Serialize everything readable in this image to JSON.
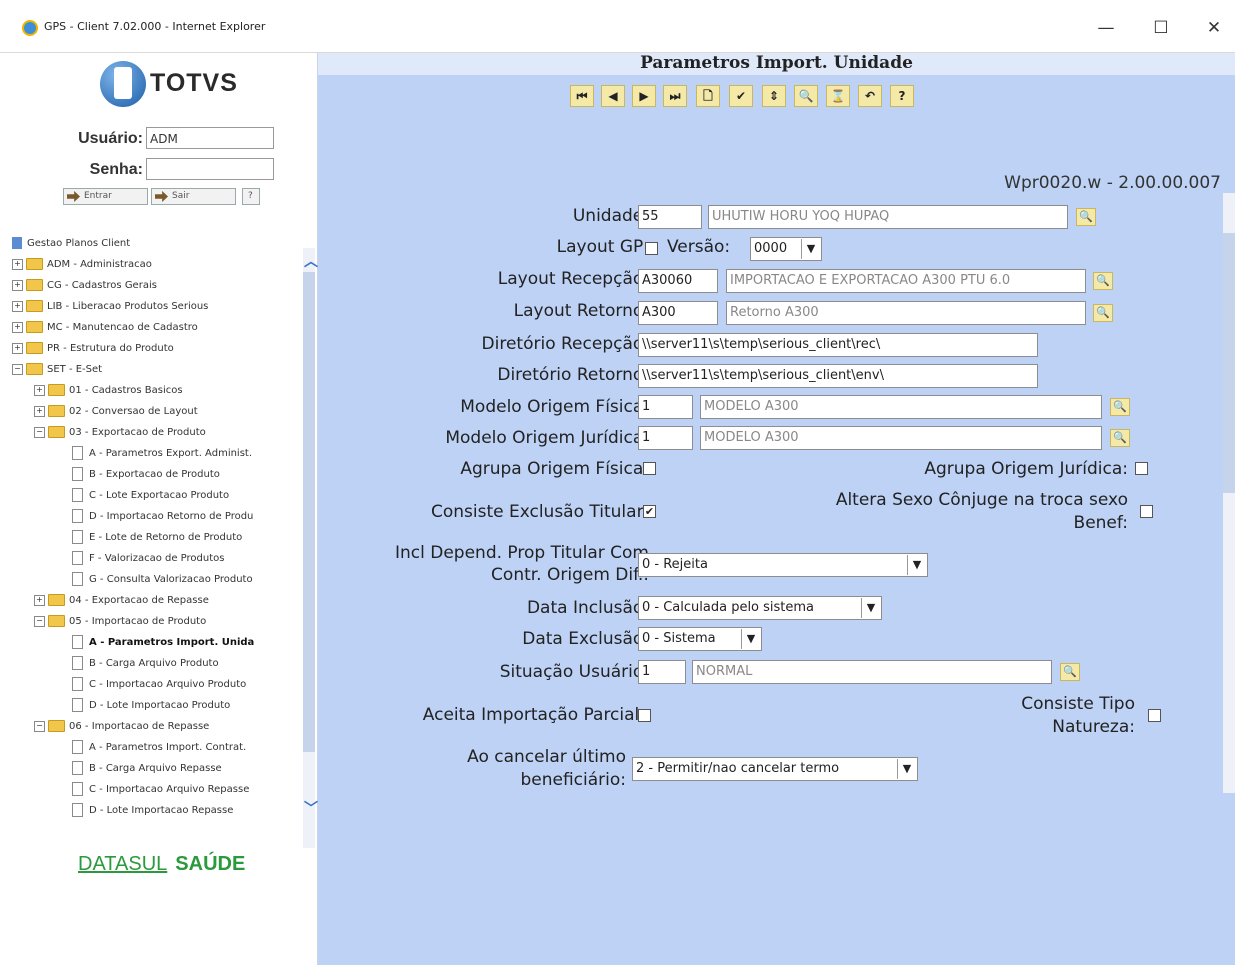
{
  "window": {
    "title": "GPS - Client 7.02.000 - Internet Explorer",
    "minimize": "—",
    "maximize": "☐",
    "close": "✕"
  },
  "login": {
    "brand": "TOTVS",
    "user_label": "Usuário:",
    "user_value": "ADM",
    "password_label": "Senha:",
    "password_value": "",
    "enter_label": "Entrar",
    "exit_label": "Sair",
    "help_label": "?"
  },
  "tree": {
    "root": "Gestao Planos Client",
    "items": [
      {
        "label": "ADM - Administracao"
      },
      {
        "label": "CG - Cadastros Gerais"
      },
      {
        "label": "LIB - Liberacao Produtos Serious"
      },
      {
        "label": "MC - Manutencao de Cadastro"
      },
      {
        "label": "PR - Estrutura do Produto"
      },
      {
        "label": "SET - E-Set"
      },
      {
        "label": "01 - Cadastros Basicos"
      },
      {
        "label": "02 - Conversao de Layout"
      },
      {
        "label": "03 - Exportacao de Produto"
      },
      {
        "label": "A - Parametros Export. Administ."
      },
      {
        "label": "B - Exportacao de Produto"
      },
      {
        "label": "C - Lote Exportacao Produto"
      },
      {
        "label": "D - Importacao Retorno de Produ"
      },
      {
        "label": "E - Lote de Retorno de Produto"
      },
      {
        "label": "F - Valorizacao de Produtos"
      },
      {
        "label": "G - Consulta Valorizacao Produto"
      },
      {
        "label": "04 - Exportacao de Repasse"
      },
      {
        "label": "05 - Importacao de Produto"
      },
      {
        "label": "A - Parametros Import. Unida"
      },
      {
        "label": "B - Carga Arquivo Produto"
      },
      {
        "label": "C - Importacao Arquivo Produto"
      },
      {
        "label": "D - Lote Importacao Produto"
      },
      {
        "label": "06 - Importacao de Repasse"
      },
      {
        "label": "A - Parametros Import. Contrat."
      },
      {
        "label": "B - Carga Arquivo Repasse"
      },
      {
        "label": "C - Importacao Arquivo Repasse"
      },
      {
        "label": "D - Lote Importacao Repasse"
      }
    ]
  },
  "footer_brand": {
    "datasul": "DATASUL",
    "saude": "SAÚDE"
  },
  "form": {
    "title": "Parametros Import. Unidade",
    "program": "Wpr0020.w - 2.00.00.007",
    "unidade_label": "Unidade:",
    "unidade_code": "55",
    "unidade_desc": "UHUTIW HORU YOQ HUPAQ",
    "layout_gp_label": "Layout GP:",
    "versao_label": "Versão:",
    "versao_value": "0000",
    "layout_recepcao_label": "Layout Recepção:",
    "layout_recepcao_code": "A30060",
    "layout_recepcao_desc": "IMPORTACAO E EXPORTACAO A300 PTU 6.0",
    "layout_retorno_label": "Layout Retorno:",
    "layout_retorno_code": "A300",
    "layout_retorno_desc": "Retorno A300",
    "dir_recepcao_label": "Diretório Recepção:",
    "dir_recepcao_value": "\\\\server11\\s\\temp\\serious_client\\rec\\",
    "dir_retorno_label": "Diretório Retorno:",
    "dir_retorno_value": "\\\\server11\\s\\temp\\serious_client\\env\\",
    "modelo_fisica_label": "Modelo Origem Física:",
    "modelo_fisica_code": "1",
    "modelo_fisica_desc": "MODELO A300",
    "modelo_juridica_label": "Modelo Origem Jurídica:",
    "modelo_juridica_code": "1",
    "modelo_juridica_desc": "MODELO A300",
    "agrupa_fisica_label": "Agrupa Origem Física:",
    "agrupa_juridica_label": "Agrupa Origem Jurídica:",
    "consiste_titular_label": "Consiste Exclusão Titular:",
    "consiste_titular_check": "✔",
    "altera_sexo_label_1": "Altera Sexo Cônjuge na troca sexo",
    "altera_sexo_label_2": "Benef:",
    "incl_dep_label_1": "Incl Depend. Prop Titular Com",
    "incl_dep_label_2": "Contr. Origem Dif.:",
    "incl_dep_value": "0 - Rejeita",
    "data_inclusao_label": "Data Inclusão:",
    "data_inclusao_value": "0 - Calculada pelo sistema",
    "data_exclusao_label": "Data Exclusão:",
    "data_exclusao_value": "0 - Sistema",
    "situacao_label": "Situação Usuário:",
    "situacao_code": "1",
    "situacao_desc": "NORMAL",
    "aceita_label": "Aceita Importação Parcial:",
    "consiste_tipo_label_1": "Consiste Tipo",
    "consiste_tipo_label_2": "Natureza:",
    "cancelar_label_1": "Ao cancelar último",
    "cancelar_label_2": "beneficiário:",
    "cancelar_value": "2 - Permitir/nao cancelar termo"
  },
  "toolbar": [
    "⏮",
    "◀",
    "▶",
    "⏭",
    "🗋",
    "✔",
    "⇕",
    "🔍",
    "⌛",
    "↶",
    "?"
  ]
}
